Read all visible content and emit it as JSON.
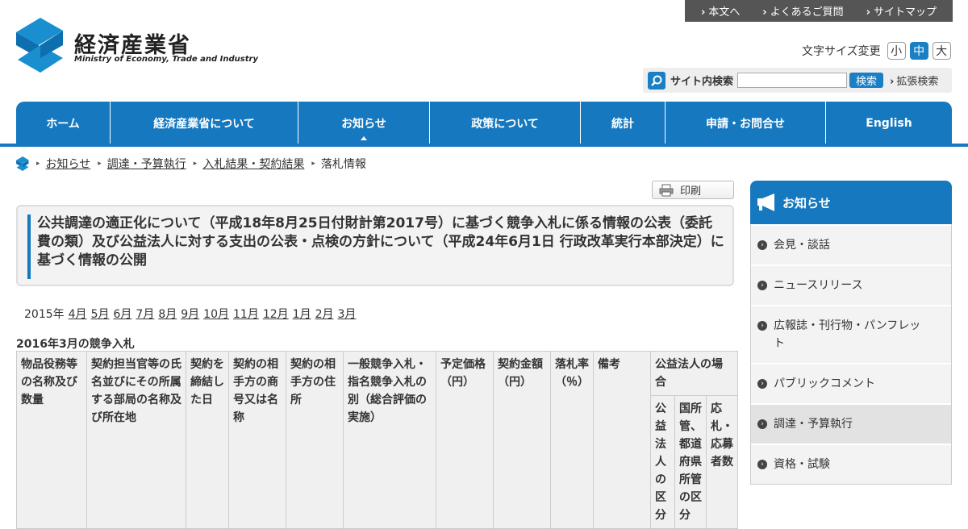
{
  "util_nav": [
    "本文へ",
    "よくあるご質問",
    "サイトマップ"
  ],
  "logo": {
    "ja": "経済産業省",
    "en": "Ministry of Economy, Trade and Industry"
  },
  "font_size": {
    "label": "文字サイズ変更",
    "options": [
      "小",
      "中",
      "大"
    ],
    "selected": "中"
  },
  "search": {
    "label": "サイト内検索",
    "placeholder": "",
    "button": "検索",
    "advanced": "拡張検索"
  },
  "gnav": [
    "ホーム",
    "経済産業省について",
    "お知らせ",
    "政策について",
    "統計",
    "申請・お問合せ",
    "English"
  ],
  "gnav_current": "お知らせ",
  "breadcrumb": [
    "お知らせ",
    "調達・予算執行",
    "入札結果・契約結果",
    "落札情報"
  ],
  "print_label": "印刷",
  "page_title": "公共調達の適正化について（平成18年8月25日付財計第2017号）に基づく競争入札に係る情報の公表（委託費の類）及び公益法人に対する支出の公表・点検の方針について（平成24年6月1日 行政改革実行本部決定）に基づく情報の公開",
  "year_label": "2015年",
  "months": [
    "4月",
    "5月",
    "6月",
    "7月",
    "8月",
    "9月",
    "10月",
    "11月",
    "12月",
    "1月",
    "2月",
    "3月"
  ],
  "section_heading": "2016年3月の競争入札",
  "table_headers": [
    "物品役務等の名称及び数量",
    "契約担当官等の氏名並びにその所属する部局の名称及び所在地",
    "契約を締結した日",
    "契約の相手方の商号又は名称",
    "契約の相手方の住所",
    "一般競争入札・指名競争入札の別（総合評価の実施）",
    "予定価格（円）",
    "契約金額（円）",
    "落札率（％）",
    "備考",
    "公益法人の場合"
  ],
  "table_subheaders": [
    "公益法人の区分",
    "国所管、都道府県所管の区分",
    "応札・応募者数"
  ],
  "sidebar": {
    "title": "お知らせ",
    "items": [
      "会見・談話",
      "ニュースリリース",
      "広報誌・刊行物・パンフレット",
      "パブリックコメント",
      "調達・予算執行",
      "資格・試験"
    ],
    "active": "調達・予算執行"
  },
  "colors": {
    "brand_blue": "#1678bf",
    "util_bar": "#555555"
  }
}
